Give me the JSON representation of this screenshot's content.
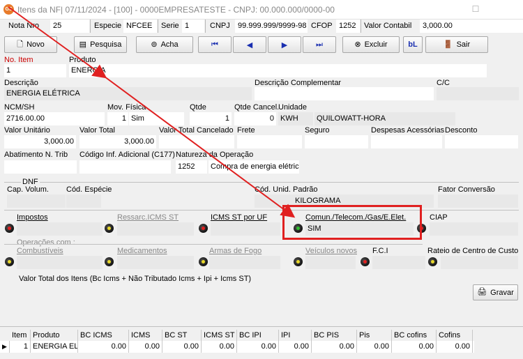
{
  "window": {
    "icon_text": "GS",
    "title": "Itens da NF|  07/11/2024 - [100] - 0000EMPRESATESTE - CNPJ: 00.000.000/0000-00"
  },
  "info_bar": {
    "nota_label": "Nota Nro",
    "nota_value": "25",
    "especie_label": "Especie",
    "especie_value": "NFCEE",
    "serie_label": "Serie",
    "serie_value": "1",
    "cnpj_label": "CNPJ",
    "cnpj_value": "99.999.999/9999-98",
    "cfop_label": "CFOP",
    "cfop_value": "1252",
    "valor_contabil_label": "Valor Contabil",
    "valor_contabil_value": "3,000.00"
  },
  "toolbar": {
    "novo": "Novo",
    "pesquisa": "Pesquisa",
    "acha": "Acha",
    "excluir": "Excluir",
    "sair": "Sair",
    "bl_icon_text": "bL"
  },
  "form": {
    "no_item_label": "No. Item",
    "no_item_value": "1",
    "produto_label": "Produto",
    "produto_value": "ENERGIA",
    "descricao_label": "Descrição",
    "descricao_value": "ENERGIA ELÉTRICA",
    "desc_complementar_label": "Descrição Complementar",
    "cc_label": "C/C",
    "ncm_label": "NCM/SH",
    "ncm_value": "2716.00.00",
    "mov_fisica_label": "Mov. Física",
    "mov_fisica_num": "1",
    "mov_fisica_value": "Sim",
    "qtde_label": "Qtde",
    "qtde_value": "1",
    "qtde_cancel_label": "Qtde Cancel.",
    "qtde_cancel_value": "0",
    "unidade_label": "Unidade",
    "unidade_code": "KWH",
    "unidade_desc": "QUILOWATT-HORA",
    "valor_unitario_label": "Valor Unitário",
    "valor_unitario_value": "3,000.00",
    "valor_total_label": "Valor Total",
    "valor_total_value": "3,000.00",
    "valor_total_cancelado_label": "Valor Total Cancelado",
    "frete_label": "Frete",
    "seguro_label": "Seguro",
    "despesas_label": "Despesas Acessórias",
    "desconto_label": "Desconto",
    "abatimento_label": "Abatimento N. Trib",
    "cod_inf_label": "Código Inf. Adicional (C177)",
    "natureza_label": "Natureza da Operação",
    "natureza_code": "1252",
    "natureza_value": "Compra de energia elétrica",
    "dnf_label": "DNF",
    "cap_volum_label": "Cap. Volum.",
    "cod_especie_label": "Cód. Espécie",
    "cod_unid_padrao_label": "Cód. Unid. Padrão",
    "cod_unid_padrao_value": "KILOGRAMA",
    "fator_conversao_label": "Fator Conversão",
    "impostos_label": "Impostos",
    "ressarc_label": "Ressarc.ICMS ST",
    "icms_st_uf_label": "ICMS ST por UF",
    "comun_label": "Comun./Telecom./Gas/E.Elet.",
    "comun_value": "SIM",
    "ciap_label": "CIAP",
    "operacoes_label": "Operações com :",
    "combustiveis_label": "Combustíveis",
    "medicamentos_label": "Medicamentos",
    "armas_label": "Armas de Fogo",
    "veiculos_label": "Veículos novos",
    "fci_label": "F.C.I",
    "rateio_label": "Rateio de Centro de Custo",
    "valor_total_itens_label": "Valor Total dos Itens  (Bc Icms + Não Tributado Icms + Ipi + Icms ST)",
    "gravar": "Gravar"
  },
  "colors": {
    "dot_red": "#e02020",
    "dot_green": "#2fbf2f",
    "dot_yellow": "#e8d82a",
    "highlight": "#e02020"
  },
  "grid": {
    "headers": [
      "Item",
      "Produto",
      "BC ICMS",
      "ICMS",
      "BC ST",
      "ICMS ST",
      "BC IPI",
      "IPI",
      "BC PIS",
      "Pis",
      "BC cofins",
      "Cofins"
    ],
    "rows": [
      [
        "1",
        "ENERGIA ELI",
        "0.00",
        "0.00",
        "0.00",
        "0.00",
        "0.00",
        "0.00",
        "0.00",
        "0.00",
        "0.00",
        "0.00"
      ]
    ]
  }
}
